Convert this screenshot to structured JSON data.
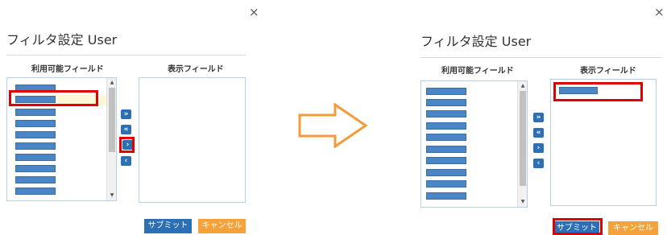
{
  "close_symbol": "×",
  "dialog_title": "フィルタ設定 User",
  "available_header": "利用可能フィールド",
  "display_header": "表示フィールド",
  "move_buttons": {
    "move_all_right": "»",
    "move_all_left": "«",
    "move_right": "›",
    "move_left": "‹"
  },
  "submit_label": "サブミット",
  "cancel_label": "キャンセル",
  "colors": {
    "item_bar": "#4a86c5",
    "button_blue": "#2d6fb5",
    "cancel_orange": "#f5a23a",
    "highlight_red": "#e00000",
    "arrow_orange": "#f29b3c"
  },
  "icons": {
    "close": "close-icon",
    "transition_arrow": "right-arrow-icon"
  }
}
